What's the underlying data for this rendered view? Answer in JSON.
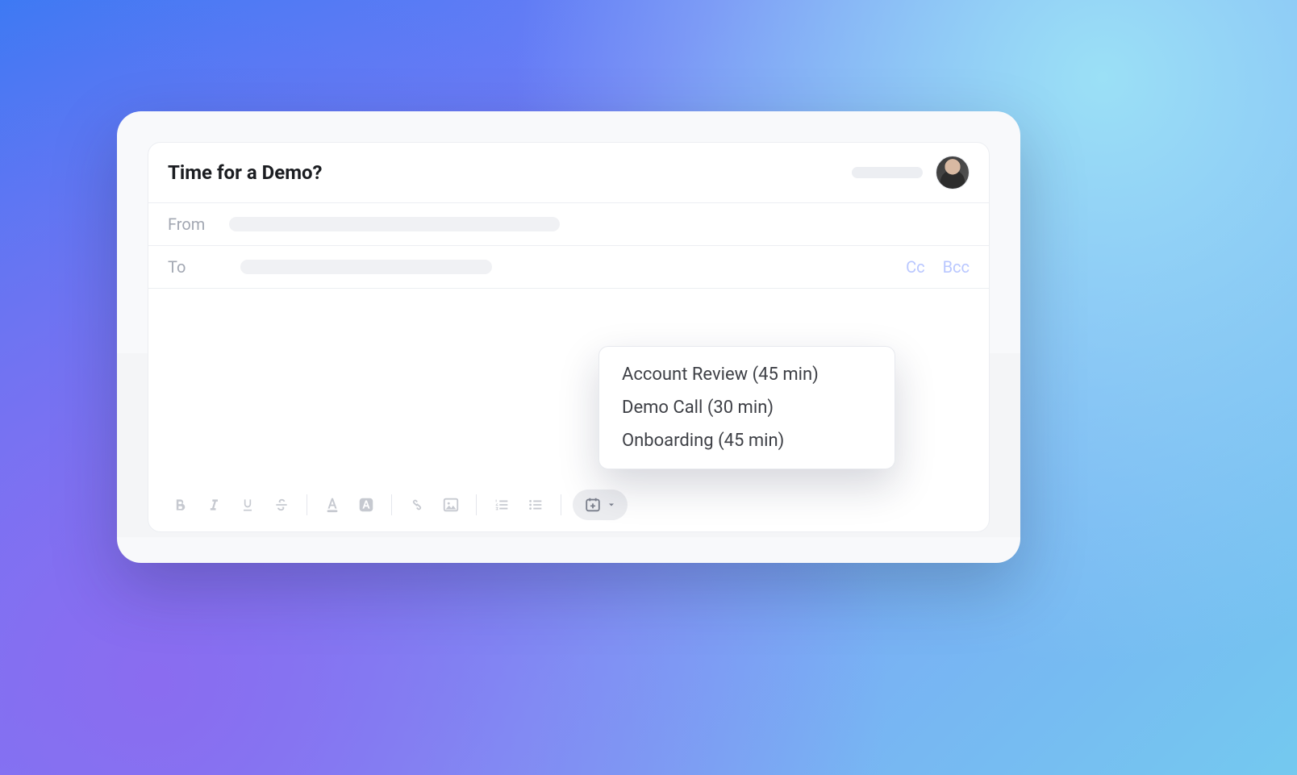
{
  "subject": "Time for a Demo?",
  "fields": {
    "from_label": "From",
    "to_label": "To",
    "cc_label": "Cc",
    "bcc_label": "Bcc"
  },
  "toolbar": {
    "bold": "Bold",
    "italic": "Italic",
    "underline": "Underline",
    "strike": "Strikethrough",
    "text_color": "Text color",
    "highlight": "Highlight color",
    "link": "Insert link",
    "image": "Insert image",
    "ordered_list": "Numbered list",
    "unordered_list": "Bulleted list",
    "calendar": "Insert meeting link"
  },
  "menu": {
    "items": [
      "Account Review (45 min)",
      "Demo Call (30 min)",
      "Onboarding (45 min)"
    ]
  },
  "colors": {
    "accent_link": "#b9c7ff",
    "text_primary": "#1b1d21",
    "text_muted": "#a3a8b3",
    "chip_bg": "#ecedf0"
  }
}
